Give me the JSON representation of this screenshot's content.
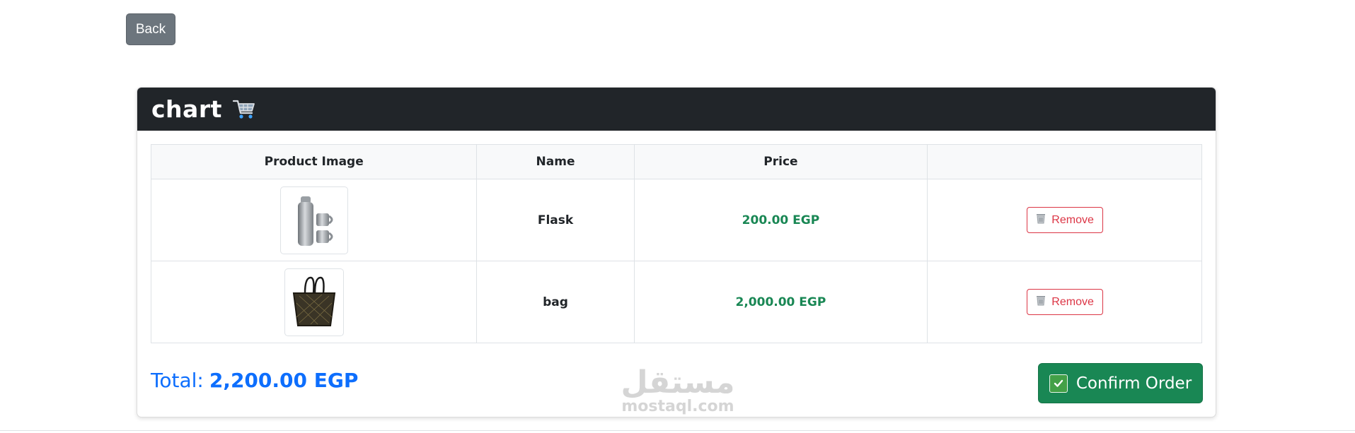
{
  "nav": {
    "back_label": "Back"
  },
  "card": {
    "title": "chart",
    "title_icon": "shopping-cart-icon"
  },
  "table": {
    "headers": [
      "Product Image",
      "Name",
      "Price",
      ""
    ],
    "rows": [
      {
        "image_icon": "flask-product-image",
        "name": "Flask",
        "price": "200.00 EGP",
        "remove_label": "Remove"
      },
      {
        "image_icon": "bag-product-image",
        "name": "bag",
        "price": "2,000.00 EGP",
        "remove_label": "Remove"
      }
    ]
  },
  "summary": {
    "total_label": "Total:",
    "total_value": "2,200.00 EGP",
    "confirm_label": "Confirm Order",
    "confirm_icon": "checkmark-icon"
  },
  "watermark": {
    "arabic": "مستقل",
    "latin": "mostaql.com"
  },
  "colors": {
    "header_bg": "#212529",
    "back_button": "#6c757d",
    "price": "#198754",
    "remove": "#dc3545",
    "total": "#0d6efd",
    "confirm": "#198754"
  }
}
